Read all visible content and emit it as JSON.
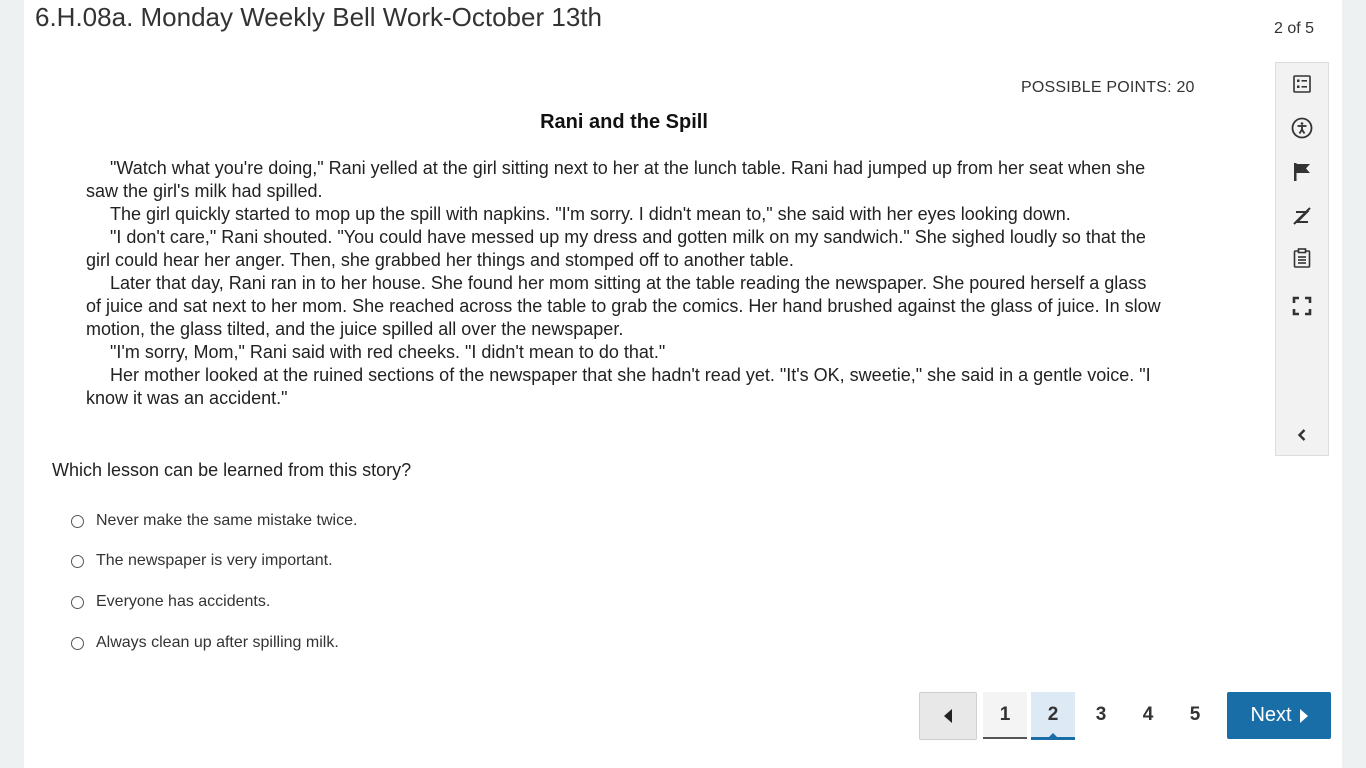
{
  "quiz": {
    "title": "6.H.08a. Monday Weekly Bell Work-October 13th",
    "progress": "2 of 5"
  },
  "question_card": {
    "possible_points": "POSSIBLE POINTS: 20",
    "story_title": "Rani and the Spill",
    "story_paragraphs": [
      "\"Watch what you're doing,\" Rani yelled at the girl sitting next to her at the lunch table. Rani had jumped up from her seat when she saw the girl's milk had spilled.",
      "The girl quickly started to mop up the spill with napkins. \"I'm sorry. I didn't mean to,\" she said with her eyes looking down.",
      "\"I don't care,\" Rani shouted. \"You could have messed up my dress and gotten milk on my sandwich.\" She sighed loudly so that the girl could hear her anger. Then, she grabbed her things and stomped off to another table.",
      "Later that day, Rani ran in to her house. She found her mom sitting at the table reading the newspaper. She poured herself a glass of juice and sat next to her mom. She reached across the table to grab the comics. Her hand brushed against the glass of juice. In slow motion, the glass tilted, and the juice spilled all over the newspaper.",
      "\"I'm sorry, Mom,\" Rani said with red cheeks. \"I didn't mean to do that.\"",
      "Her mother looked at the ruined sections of the newspaper that she hadn't read yet. \"It's OK, sweetie,\" she said in a gentle voice. \"I know it was an accident.\""
    ],
    "question": "Which lesson can be learned from this story?",
    "options": [
      "Never make the same mistake twice.",
      "The newspaper is very important.",
      "Everyone has accidents.",
      "Always clean up after spilling milk."
    ]
  },
  "toolbar": {
    "tools": [
      "question-list-icon",
      "accessibility-icon",
      "flag-icon",
      "eliminate-icon",
      "notepad-icon",
      "fullscreen-icon",
      "collapse-icon"
    ]
  },
  "pagination": {
    "pages": [
      "1",
      "2",
      "3",
      "4",
      "5"
    ],
    "current_page": "2",
    "next_label": "Next"
  },
  "colors": {
    "accent": "#1a6ea8",
    "page_background": "#eef1f2"
  }
}
